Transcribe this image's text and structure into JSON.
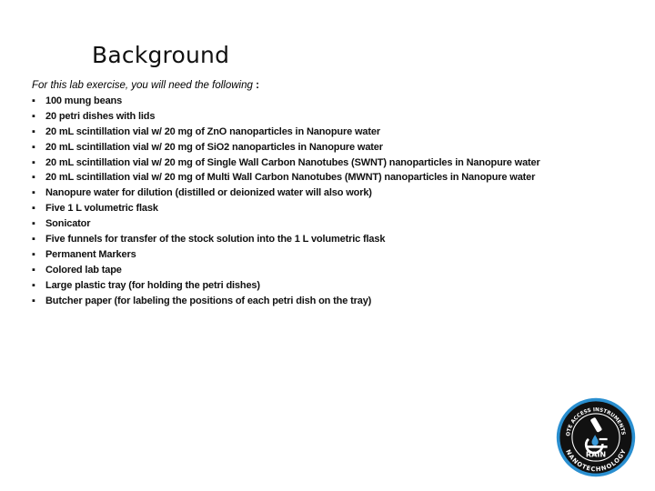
{
  "slide": {
    "title": "Background",
    "intro": "For this lab exercise, you will need the following",
    "intro_colon": " :",
    "bullet_glyph": "▪",
    "items": [
      "100 mung beans",
      "20 petri dishes with lids",
      "20 mL scintillation vial w/ 20 mg of ZnO nanoparticles in Nanopure water",
      "20 mL scintillation vial w/ 20 mg of SiO2 nanoparticles in Nanopure water",
      "20 mL scintillation vial w/ 20 mg of Single Wall Carbon Nanotubes (SWNT) nanoparticles in Nanopure water",
      "20 mL scintillation vial w/ 20 mg of Multi Wall Carbon Nanotubes (MWNT) nanoparticles in Nanopure water",
      "Nanopure water for dilution (distilled or deionized water will also work)",
      "Five 1 L volumetric flask",
      "Sonicator",
      "Five funnels for transfer of the stock solution into the 1 L volumetric flask",
      "Permanent Markers",
      "Colored lab tape",
      "Large plastic tray (for holding the petri dishes)",
      "Butcher paper (for labeling the positions of each petri dish on the tray)"
    ]
  },
  "logo": {
    "top_arc_text": "REMOTE ACCESS INSTRUMENTS FOR",
    "center_text": "RAIN",
    "bottom_arc_text": "NANOTECHNOLOGY",
    "icon": "microscope-icon",
    "colors": {
      "ring": "#2a8fd0",
      "fill": "#111111",
      "text": "#ffffff",
      "drop": "#3a9ad9"
    }
  }
}
